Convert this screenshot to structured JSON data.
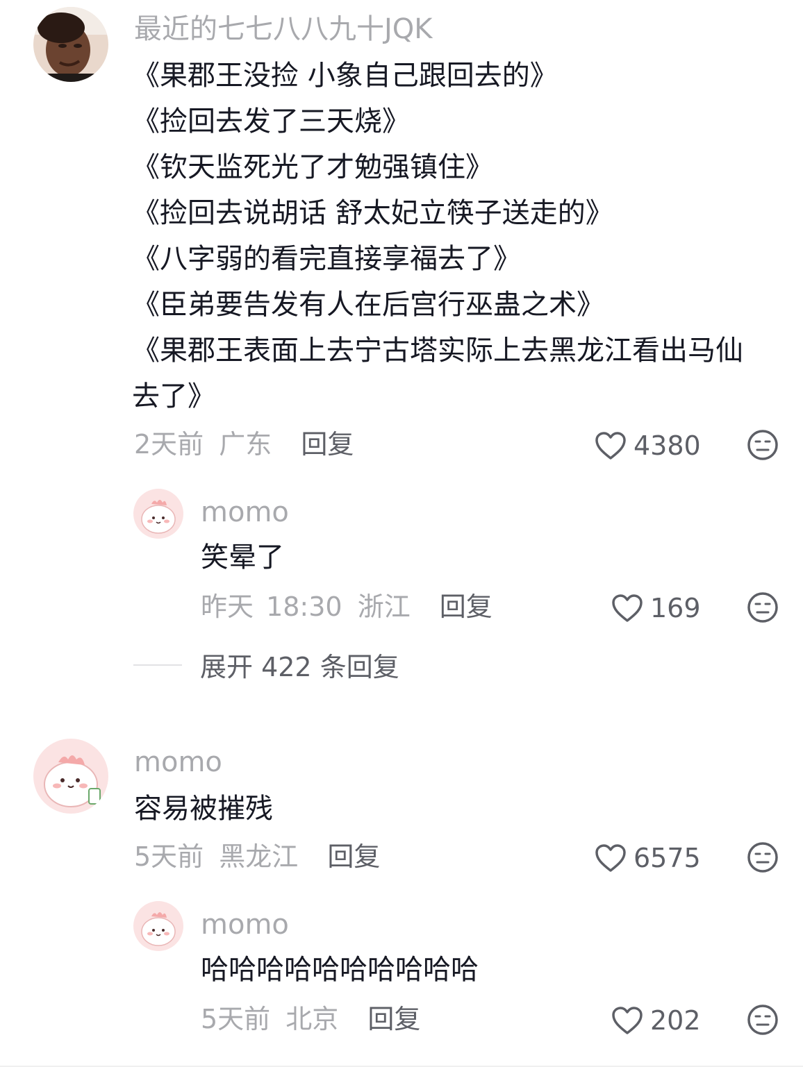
{
  "comments": [
    {
      "username": "最近的七七八八九十JQK",
      "lines": [
        "《果郡王没捡 小象自己跟回去的》",
        "《捡回去发了三天烧》",
        "《钦天监死光了才勉强镇住》",
        "《捡回去说胡话 舒太妃立筷子送走的》",
        "《八字弱的看完直接享福去了》",
        "《臣弟要告发有人在后宫行巫蛊之术》",
        "《果郡王表面上去宁古塔实际上去黑龙江看出马仙",
        "去了》"
      ],
      "time": "2天前",
      "location": "广东",
      "reply_label": "回复",
      "likes": "4380",
      "avatar_icon": "photo-avatar",
      "reply": {
        "username": "momo",
        "text": "笑晕了",
        "time": "昨天 18:30",
        "location": "浙江",
        "reply_label": "回复",
        "likes": "169",
        "avatar_icon": "pink-cartoon-avatar"
      },
      "expand_label": "展开 422 条回复"
    },
    {
      "username": "momo",
      "lines": [
        "容易被摧残"
      ],
      "time": "5天前",
      "location": "黑龙江",
      "reply_label": "回复",
      "likes": "6575",
      "avatar_icon": "pink-cartoon-avatar",
      "reply": {
        "username": "momo",
        "text": "哈哈哈哈哈哈哈哈哈哈",
        "time": "5天前",
        "location": "北京",
        "reply_label": "回复",
        "likes": "202",
        "avatar_icon": "pink-cartoon-avatar"
      }
    }
  ],
  "colors": {
    "text": "#161823",
    "secondary": "#a8a9ad",
    "action": "#5d5f66",
    "avatar_pink": "#fbe3e3"
  }
}
